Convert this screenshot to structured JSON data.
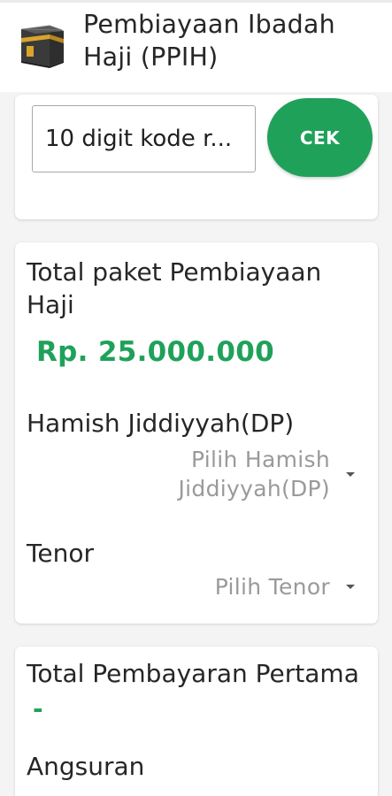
{
  "header": {
    "title": "Pembiayaan Ibadah Haji (PPIH)",
    "icon": "kaaba-icon"
  },
  "code_card": {
    "input_placeholder": "10 digit kode r...",
    "button_label": "CEK"
  },
  "package_card": {
    "total_label": "Total paket Pembiayaan Haji",
    "total_amount": "Rp. 25.000.000",
    "dp_label": "Hamish Jiddiyyah(DP)",
    "dp_select": "Pilih Hamish Jiddiyyah(DP)",
    "tenor_label": "Tenor",
    "tenor_select": "Pilih Tenor"
  },
  "payment_card": {
    "first_payment_label": "Total Pembayaran Pertama",
    "first_payment_value": "-",
    "installment_label": "Angsuran"
  },
  "colors": {
    "accent": "#1fa15a",
    "placeholder_gray": "#9a9a9a",
    "background": "#f4f4f4"
  }
}
